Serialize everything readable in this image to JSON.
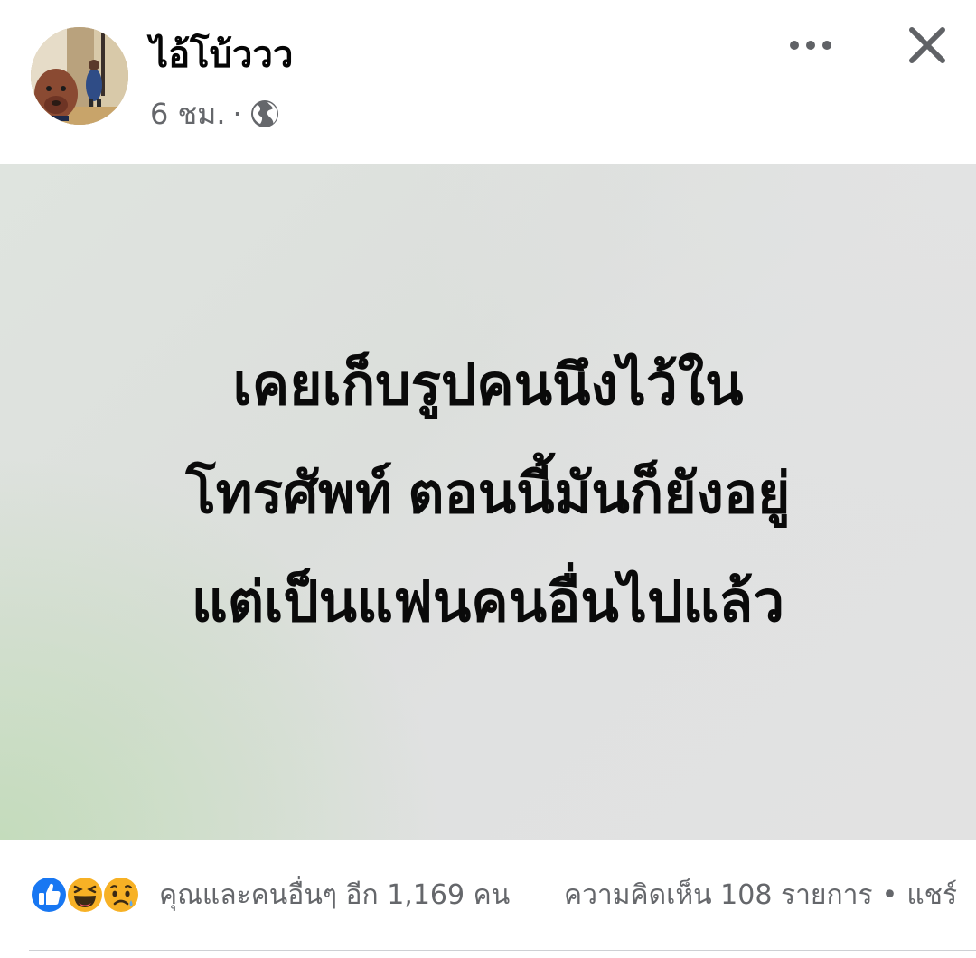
{
  "post": {
    "author": "ไอ้โบ้ววว",
    "timestamp": "6 ชม.",
    "separator": "·",
    "privacy_icon": "globe-icon",
    "more_icon": "more-dots-icon",
    "close_icon": "close-icon",
    "text_lines": [
      "เคยเก็บรูปคนนึงไว้ใน",
      "โทรศัพท์ ตอนนี้มันก็ยังอยู่",
      "แต่เป็นแฟนคนอื่นไปแล้ว"
    ],
    "background_colors": [
      "#c4dcbc",
      "#e2e2e2"
    ]
  },
  "engagement": {
    "reaction_icons": [
      "like-reaction-icon",
      "haha-reaction-icon",
      "sad-reaction-icon"
    ],
    "summary": "คุณและคนอื่นๆ อีก 1,169 คน",
    "comments": "ความคิดเห็น 108 รายการ",
    "bullet": "•",
    "shares": "แชร์"
  },
  "colors": {
    "like_blue": "#1877f2",
    "emoji_yellow": "#f7b125",
    "secondary_text": "#65676b"
  }
}
